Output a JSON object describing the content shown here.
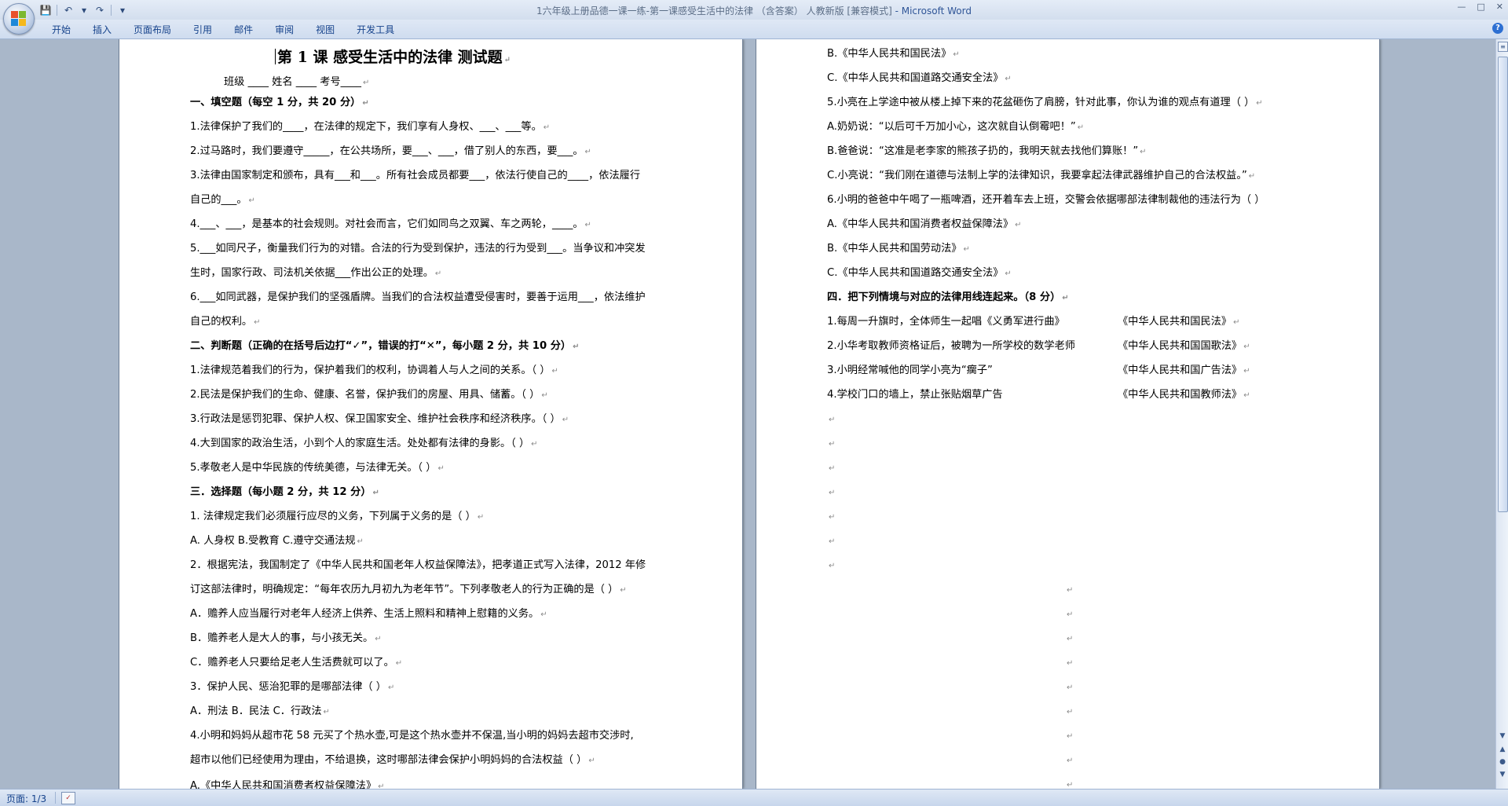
{
  "window": {
    "title": "1六年级上册品德一课一练-第一课感受生活中的法律 （含答案） 人教新版 [兼容模式]",
    "app_name": " - Microsoft Word",
    "controls": [
      "—",
      "□",
      "✕"
    ]
  },
  "qat": {
    "save_icon": "💾",
    "undo_icon": "↶",
    "undo_dropdown": "▾",
    "redo_icon": "↷",
    "customize_icon": "▾"
  },
  "ribbon": {
    "tabs": [
      "开始",
      "插入",
      "页面布局",
      "引用",
      "邮件",
      "审阅",
      "视图",
      "开发工具"
    ],
    "help": "?"
  },
  "status": {
    "page": "页面: 1/3",
    "proof_icon": "✓"
  },
  "para_mark": "↵",
  "left_page": {
    "title": "第 1 课 感受生活中的法律   测试题",
    "info": "班级 ____                   姓名 ____                      考号____",
    "lines": [
      "一、填空题（每空 1 分，共 20 分）",
      "1.法律保护了我们的____，在法律的规定下，我们享有人身权、___、___等。",
      "2.过马路时，我们要遵守_____，在公共场所，要___、___，借了别人的东西，要___。",
      "3.法律由国家制定和颁布，具有___和___。所有社会成员都要___，依法行使自己的____，依法履行",
      "自己的___。",
      "4.___、___，是基本的社会规则。对社会而言，它们如同鸟之双翼、车之两轮，____。",
      "5.___如同尺子，衡量我们行为的对错。合法的行为受到保护，违法的行为受到___。当争议和冲突发",
      "生时，国家行政、司法机关依据___作出公正的处理。",
      "6.___如同武器，是保护我们的坚强盾牌。当我们的合法权益遭受侵害时，要善于运用___，依法维护",
      "自己的权利。",
      "二、判断题（正确的在括号后边打“✓”，错误的打“✕”，每小题 2 分，共 10 分）",
      "1.法律规范着我们的行为，保护着我们的权利，协调着人与人之间的关系。（   ）",
      "2.民法是保护我们的生命、健康、名誉，保护我们的房屋、用具、储蓄。（   ）",
      "3.行政法是惩罚犯罪、保护人权、保卫国家安全、维护社会秩序和经济秩序。（   ）",
      "4.大到国家的政治生活，小到个人的家庭生活。处处都有法律的身影。（   ）",
      "5.孝敬老人是中华民族的传统美德，与法律无关。（     ）",
      "三．选择题（每小题 2 分，共 12 分）",
      "1. 法律规定我们必须履行应尽的义务，下列属于义务的是（     ）",
      "A. 人身权 B.受教育 C.遵守交通法规",
      "2．根据宪法，我国制定了《中华人民共和国老年人权益保障法》，把孝道正式写入法律，2012 年修",
      "订这部法律时，明确规定：“每年农历九月初九为老年节”。下列孝敬老人的行为正确的是（   ）",
      "A．赡养人应当履行对老年人经济上供养、生活上照料和精神上慰籍的义务。",
      "B．赡养老人是大人的事，与小孩无关。",
      "C．赡养老人只要给足老人生活费就可以了。",
      "3．保护人民、惩治犯罪的是哪部法律（   ）",
      "A．刑法          B．民法          C．行政法",
      "4.小明和妈妈从超市花 58 元买了个热水壶,可是这个热水壶并不保温,当小明的妈妈去超市交涉时,",
      "超市以他们已经使用为理由，不给退换，这时哪部法律会保护小明妈妈的合法权益（     ）",
      "A.《中华人民共和国消费者权益保障法》"
    ]
  },
  "right_page": {
    "lines": [
      "B.《中华人民共和国民法》",
      "C.《中华人民共和国道路交通安全法》",
      "5.小亮在上学途中被从楼上掉下来的花盆砸伤了肩膀，针对此事，你认为谁的观点有道理（   ）",
      "A.奶奶说：“以后可千万加小心，这次就自认倒霉吧！”",
      "B.爸爸说：“这准是老李家的熊孩子扔的，我明天就去找他们算账！”",
      "C.小亮说：“我们刚在道德与法制上学的法律知识，我要拿起法律武器维护自己的合法权益。”",
      "6.小明的爸爸中午喝了一瓶啤酒，还开着车去上班，交警会依据哪部法律制裁他的违法行为（    ）",
      "A.《中华人民共和国消费者权益保障法》",
      "B.《中华人民共和国劳动法》",
      "C.《中华人民共和国道路交通安全法》",
      "四．把下列情境与对应的法律用线连起来。（8 分）"
    ],
    "matching": [
      {
        "left": "1.每周一升旗时，全体师生一起唱《义勇军进行曲》",
        "right": "《中华人民共和国民法》"
      },
      {
        "left": "2.小华考取教师资格证后，被聘为一所学校的数学老师",
        "right": "《中华人民共和国国歌法》"
      },
      {
        "left": "3.小明经常喊他的同学小亮为“瘸子”",
        "right": "《中华人民共和国广告法》"
      },
      {
        "left": "4.学校门口的墙上，禁止张贴烟草广告",
        "right": "《中华人民共和国教师法》"
      }
    ]
  }
}
